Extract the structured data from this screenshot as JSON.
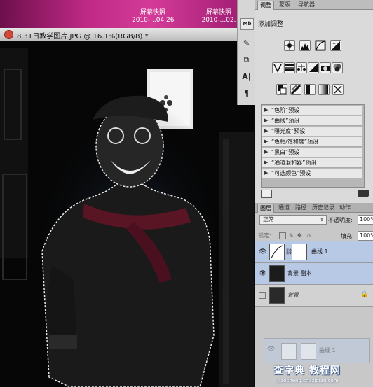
{
  "desktop": {
    "screenshot_1": {
      "label": "屏幕快照",
      "date": "2010-...04.26"
    },
    "screenshot_2": {
      "label": "屏幕快照",
      "date": "2010-...02."
    }
  },
  "document": {
    "title": "8.31日教学图片.JPG @ 16.1%(RGB/8) *"
  },
  "tool_icons": [
    "mini-bridge-icon",
    "brush-preset-icon",
    "clone-source-icon",
    "character-icon",
    "paragraph-icon"
  ],
  "tool_labels": {
    "mini_bridge": "Mb",
    "character": "A|",
    "paragraph": "¶"
  },
  "adjustments": {
    "tabs": [
      "调整",
      "蒙版",
      "导航器"
    ],
    "title": "添加调整",
    "presets": [
      "“色阶”预设",
      "“曲线”预设",
      "“曝光度”预设",
      "“色相/饱和度”预设",
      "“黑白”预设",
      "“通道混和器”预设",
      "“可选颜色”预设"
    ]
  },
  "layers_panel": {
    "tabs": [
      "图层",
      "通道",
      "路径",
      "历史记录",
      "动作"
    ],
    "blend_mode": "正常",
    "opacity_label": "不透明度:",
    "opacity_value": "100%",
    "lock_label": "锁定:",
    "fill_label": "填充:",
    "fill_value": "100%",
    "layers": [
      {
        "name": "曲线 1",
        "selected": true
      },
      {
        "name": "背景 副本",
        "selected": false
      },
      {
        "name": "背景",
        "selected": false,
        "locked": true
      }
    ],
    "drag_ghost_name": "曲线 1"
  },
  "watermark": {
    "main": "查字典 教程网",
    "url": "jiaocheng.chazidian.com"
  },
  "colors": {
    "accent_blue": "#b8c9e6",
    "desktop_magenta": "#c02a86"
  }
}
